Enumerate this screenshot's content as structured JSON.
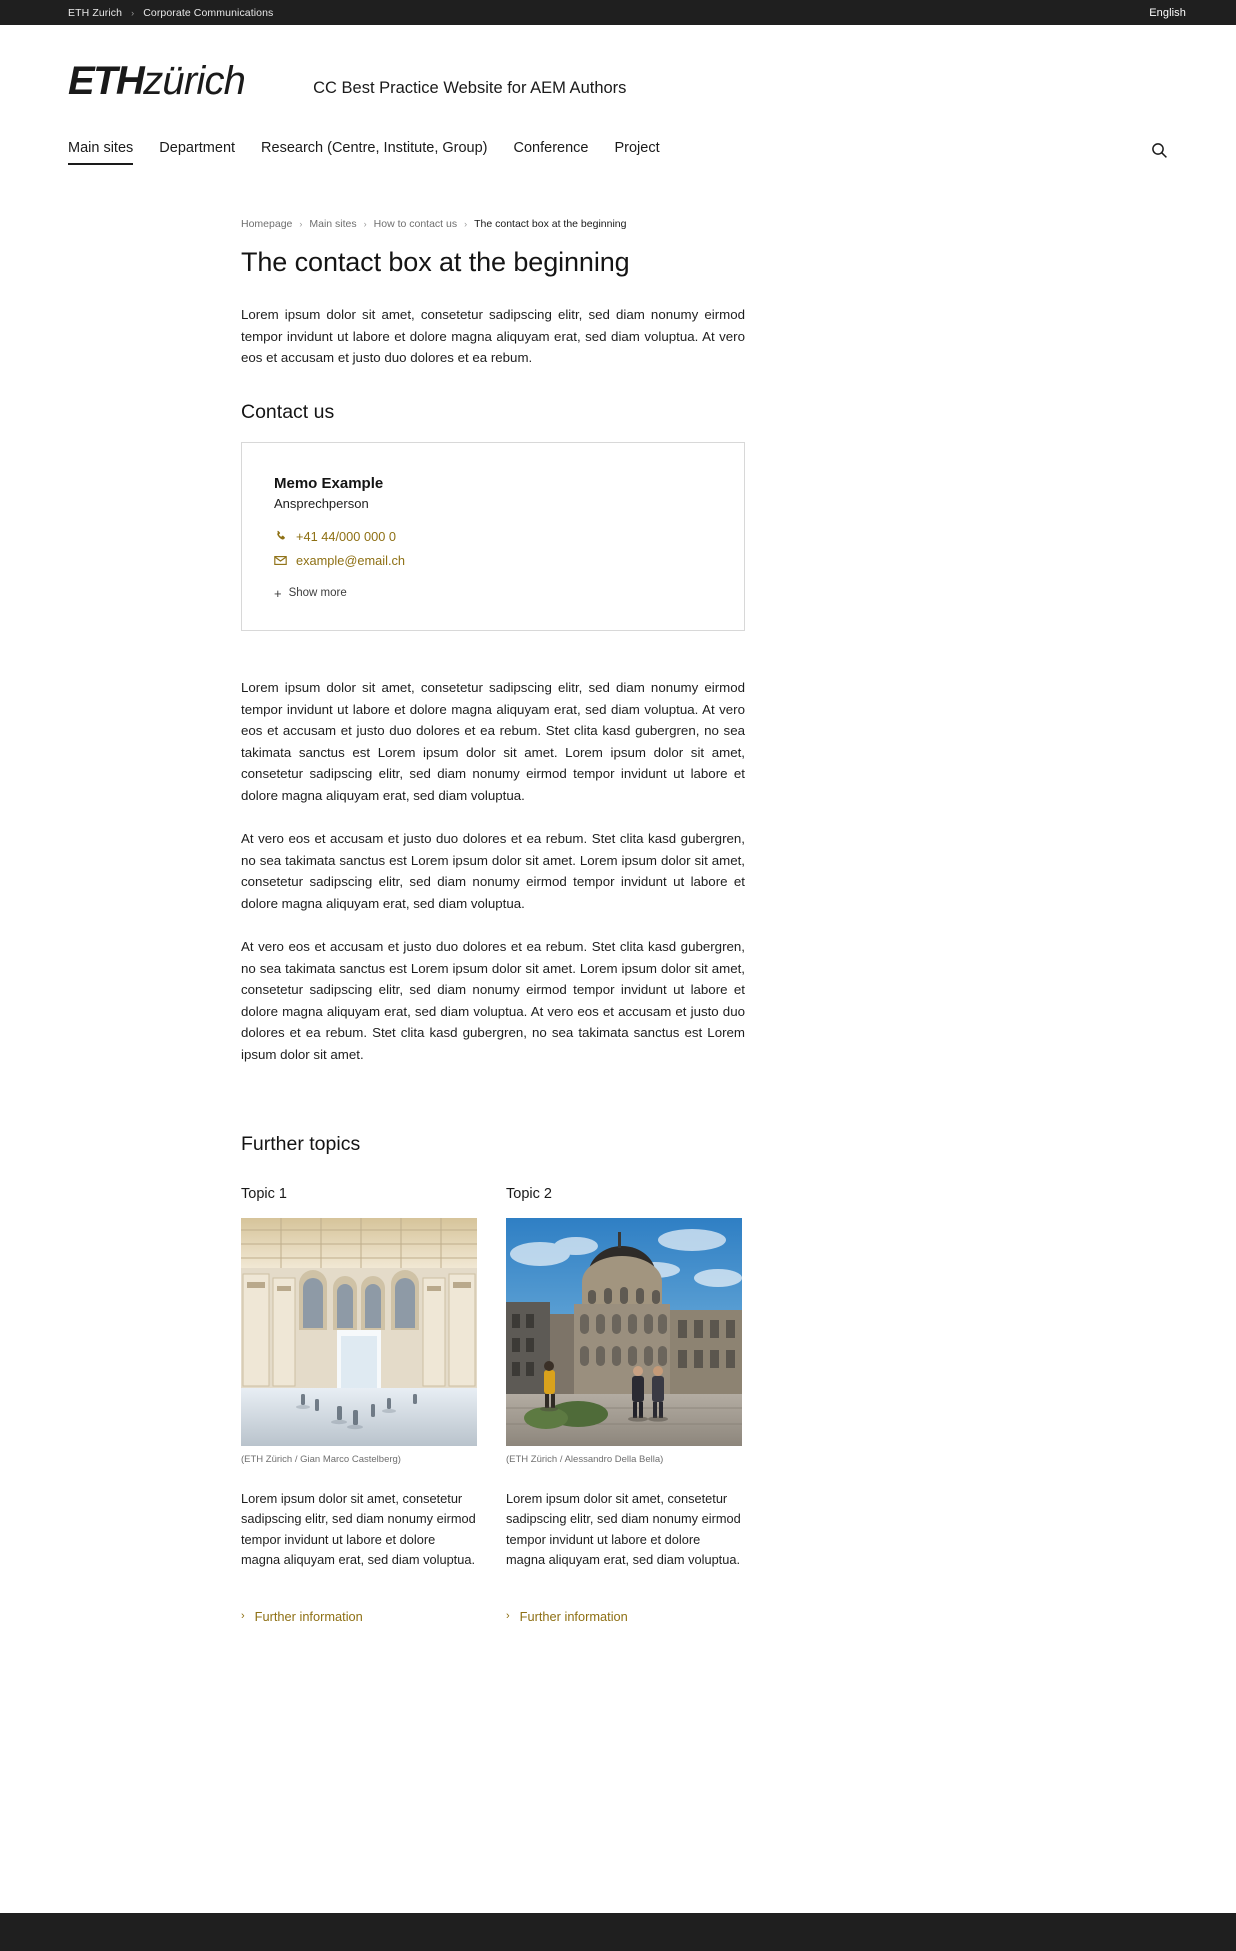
{
  "topbar": {
    "org": "ETH Zurich",
    "separator": "›",
    "unit": "Corporate Communications",
    "language": "English"
  },
  "header": {
    "logo_bold": "ETH",
    "logo_light": "zürich",
    "site_title": "CC Best Practice Website for AEM Authors"
  },
  "nav": {
    "items": [
      {
        "label": "Main sites",
        "active": true
      },
      {
        "label": "Department",
        "active": false
      },
      {
        "label": "Research (Centre, Institute, Group)",
        "active": false
      },
      {
        "label": "Conference",
        "active": false
      },
      {
        "label": "Project",
        "active": false
      }
    ],
    "search_icon": "search-icon"
  },
  "breadcrumb": {
    "separator": "›",
    "items": [
      {
        "label": "Homepage",
        "current": false
      },
      {
        "label": "Main sites",
        "current": false
      },
      {
        "label": "How to contact us",
        "current": false
      },
      {
        "label": "The contact box at the beginning",
        "current": true
      }
    ]
  },
  "main": {
    "page_title": "The contact box at the beginning",
    "intro_paragraph": "Lorem ipsum dolor sit amet, consetetur sadipscing elitr, sed diam nonumy eirmod tempor invidunt ut labore et dolore magna aliquyam erat, sed diam voluptua. At vero eos et accusam et justo duo dolores et ea rebum.",
    "contact_section_title": "Contact us",
    "contact": {
      "name": "Memo Example",
      "role": "Ansprechperson",
      "phone": "+41 44/000 000 0",
      "phone_icon": "phone-icon",
      "email": "example@email.ch",
      "email_icon": "mail-icon",
      "show_more_label": "Show more",
      "show_more_icon": "plus-icon"
    },
    "paragraphs": [
      "Lorem ipsum dolor sit amet, consetetur sadipscing elitr, sed diam nonumy eirmod tempor invidunt ut labore et dolore magna aliquyam erat, sed diam voluptua. At vero eos et accusam et justo duo dolores et ea rebum. Stet clita kasd gubergren, no sea takimata sanctus est Lorem ipsum dolor sit amet. Lorem ipsum dolor sit amet, consetetur sadipscing elitr, sed diam nonumy eirmod tempor invidunt ut labore et dolore magna aliquyam erat, sed diam voluptua.",
      "At vero eos et accusam et justo duo dolores et ea rebum. Stet clita kasd gubergren, no sea takimata sanctus est Lorem ipsum dolor sit amet. Lorem ipsum dolor sit amet, consetetur sadipscing elitr, sed diam nonumy eirmod tempor invidunt ut labore et dolore magna aliquyam erat, sed diam voluptua.",
      "At vero eos et accusam et justo duo dolores et ea rebum. Stet clita kasd gubergren, no sea takimata sanctus est Lorem ipsum dolor sit amet. Lorem ipsum dolor sit amet, consetetur sadipscing elitr, sed diam nonumy eirmod tempor invidunt ut labore et dolore magna aliquyam erat, sed diam voluptua. At vero eos et accusam et justo duo dolores et ea rebum. Stet clita kasd gubergren, no sea takimata sanctus est Lorem ipsum dolor sit amet."
    ]
  },
  "further": {
    "title": "Further topics",
    "topics": [
      {
        "title": "Topic 1",
        "image_alt": "ETH main building interior hall with arcades",
        "caption": "(ETH Zürich / Gian Marco Castelberg)",
        "text": "Lorem ipsum dolor sit amet, consetetur sadipscing elitr, sed diam nonumy eirmod tempor invidunt ut labore et dolore magna aliquyam erat, sed diam voluptua.",
        "link_label": "Further information",
        "link_icon": "chevron-right-icon"
      },
      {
        "title": "Topic 2",
        "image_alt": "ETH main building exterior dome with people on plaza",
        "caption": "(ETH Zürich / Alessandro Della Bella)",
        "text": "Lorem ipsum dolor sit amet, consetetur sadipscing elitr, sed diam nonumy eirmod tempor invidunt ut labore et dolore magna aliquyam erat, sed diam voluptua.",
        "link_label": "Further information",
        "link_icon": "chevron-right-icon"
      }
    ]
  },
  "colors": {
    "accent_gold": "#8e7014",
    "dark_bar": "#1f1f1f",
    "text": "#1a1a1a",
    "muted": "#6f6f6f"
  }
}
